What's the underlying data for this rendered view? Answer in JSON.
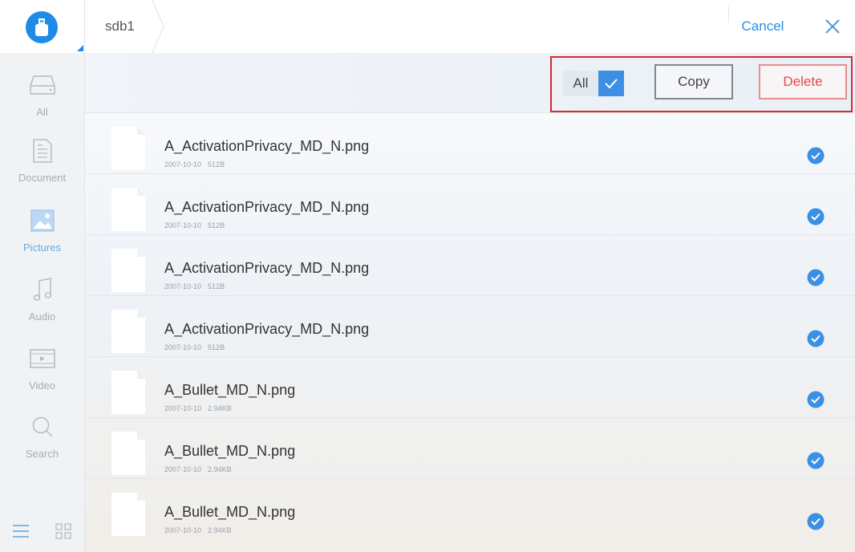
{
  "header": {
    "breadcrumb": "sdb1",
    "cancel_label": "Cancel"
  },
  "sidebar": {
    "items": [
      {
        "label": "All",
        "icon": "drive-icon",
        "active": false
      },
      {
        "label": "Document",
        "icon": "document-icon",
        "active": false
      },
      {
        "label": "Pictures",
        "icon": "pictures-icon",
        "active": true
      },
      {
        "label": "Audio",
        "icon": "music-note-icon",
        "active": false
      },
      {
        "label": "Video",
        "icon": "video-icon",
        "active": false
      },
      {
        "label": "Search",
        "icon": "search-icon",
        "active": false
      }
    ],
    "view_modes": [
      "list-view-icon",
      "grid-view-icon"
    ]
  },
  "toolbar": {
    "all_label": "All",
    "all_checked": true,
    "copy_label": "Copy",
    "delete_label": "Delete"
  },
  "files": [
    {
      "name": "A_ActivationPrivacy_MD_N.png",
      "date": "2007-10-10",
      "size": "512B",
      "checked": true
    },
    {
      "name": "A_ActivationPrivacy_MD_N.png",
      "date": "2007-10-10",
      "size": "512B",
      "checked": true
    },
    {
      "name": "A_ActivationPrivacy_MD_N.png",
      "date": "2007-10-10",
      "size": "512B",
      "checked": true
    },
    {
      "name": "A_ActivationPrivacy_MD_N.png",
      "date": "2007-10-10",
      "size": "512B",
      "checked": true
    },
    {
      "name": "A_Bullet_MD_N.png",
      "date": "2007-10-10",
      "size": "2.94KB",
      "checked": true
    },
    {
      "name": "A_Bullet_MD_N.png",
      "date": "2007-10-10",
      "size": "2.94KB",
      "checked": true
    },
    {
      "name": "A_Bullet_MD_N.png",
      "date": "2007-10-10",
      "size": "2.94KB",
      "checked": true
    }
  ],
  "colors": {
    "accent": "#2b8de6",
    "delete": "#e4484f",
    "highlight_frame": "#d82b30"
  }
}
